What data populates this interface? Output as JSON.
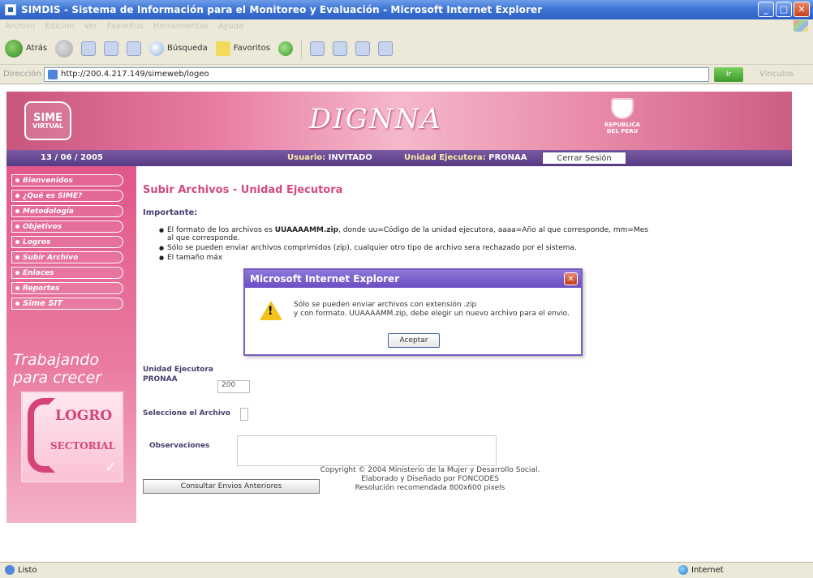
{
  "window": {
    "title": "SIMDIS - Sistema de Información para el Monitoreo y Evaluación - Microsoft Internet Explorer",
    "menu": [
      "Archivo",
      "Edición",
      "Ver",
      "Favoritos",
      "Herramientas",
      "Ayuda"
    ]
  },
  "toolbar": {
    "back_label": "Atrás",
    "search_label": "Búsqueda",
    "favorites_label": "Favoritos"
  },
  "address": {
    "label": "Dirección",
    "url": "http://200.4.217.149/simeweb/logeo",
    "go_label": "Ir",
    "links_label": "Vínculos"
  },
  "header": {
    "logo_text": "SIME",
    "logo_sub": "VIRTUAL",
    "brand": "DIGNNA",
    "shield_line1": "REPUBLICA",
    "shield_line2": "DEL PERU"
  },
  "infobar": {
    "date": "13 / 06 / 2005",
    "user_label": "Usuario:",
    "user_value": "INVITADO",
    "unit_label": "Unidad Ejecutora:",
    "unit_value": "PRONAA",
    "logout_label": "Cerrar Sesión"
  },
  "sidebar": {
    "items": [
      {
        "label": "Bienvenidos"
      },
      {
        "label": "¿Qué es SIME?"
      },
      {
        "label": "Metodología"
      },
      {
        "label": "Objetivos"
      },
      {
        "label": "Logros"
      },
      {
        "label": "Subir Archivo"
      },
      {
        "label": "Enlaces"
      },
      {
        "label": "Reportes"
      },
      {
        "label": "Sime SIT"
      }
    ],
    "slogan_line1": "Trabajando",
    "slogan_line2": "para crecer",
    "logro_t1": "LOGRO",
    "logro_t2": "SECTORIAL"
  },
  "main": {
    "title": "Subir Archivos - Unidad Ejecutora",
    "important_label": "Importante:",
    "rule1_a": "El formato de los archivos es ",
    "rule1_b": "UUAAAAMM.zip",
    "rule1_c": ", donde uu=Código de la unidad ejecutora, aaaa=Año al que corresponde, mm=Mes al que corresponde.",
    "rule2": "Sólo se pueden enviar archivos comprimidos (zip), cualquier otro tipo de archivo sera rechazado por el sistema.",
    "rule3": "El tamaño máx",
    "unit_field_label": "Unidad Ejecutora",
    "unit_field_value": "PRONAA",
    "period_value": "200",
    "file_label": "Seleccione el Archivo",
    "obs_label": "Observaciones",
    "history_button": "Consultar Envios Anteriores"
  },
  "footer": {
    "line1": "Copyright © 2004 Ministerio de la Mujer y Desarrollo Social.",
    "line2": "Elaborado y Diseñado por FONCODES",
    "line3": "Resolución recomendada 800x600 pixels"
  },
  "dialog": {
    "title": "Microsoft Internet Explorer",
    "message_line1": "Sólo se pueden enviar archivos con extensión .zip",
    "message_line2": "y con formato. UUAAAAMM.zip, debe elegir un nuevo archivo para el envio.",
    "ok_label": "Aceptar"
  },
  "status": {
    "left": "Listo",
    "zone": "Internet"
  }
}
